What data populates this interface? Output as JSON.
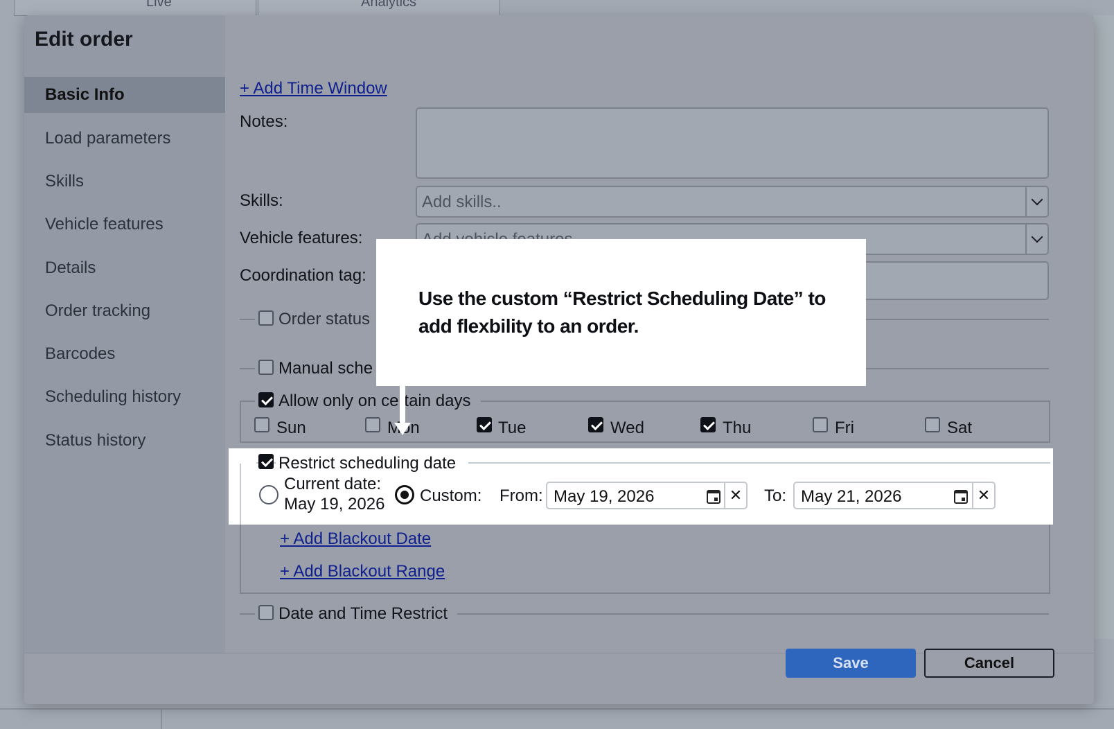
{
  "background": {
    "tabs": [
      {
        "label": "Live"
      },
      {
        "label": "Analytics"
      }
    ]
  },
  "modal": {
    "title": "Edit order",
    "nav": [
      {
        "label": "Basic Info",
        "active": true
      },
      {
        "label": "Load parameters"
      },
      {
        "label": "Skills"
      },
      {
        "label": "Vehicle features"
      },
      {
        "label": "Details"
      },
      {
        "label": "Order tracking"
      },
      {
        "label": "Barcodes"
      },
      {
        "label": "Scheduling history"
      },
      {
        "label": "Status history"
      }
    ],
    "form": {
      "add_time_window": "+ Add Time Window",
      "notes_label": "Notes:",
      "notes_value": "",
      "skills_label": "Skills:",
      "skills_placeholder": "Add skills..",
      "vehicle_features_label": "Vehicle features:",
      "vehicle_features_placeholder": "Add vehicle features",
      "coordination_tag_label": "Coordination tag:",
      "order_status_label": "Order status",
      "manual_schedule_label": "Manual sche",
      "allow_days_label": "Allow only on certain days",
      "days": [
        {
          "label": "Sun",
          "checked": false
        },
        {
          "label": "Mon",
          "checked": false
        },
        {
          "label": "Tue",
          "checked": true
        },
        {
          "label": "Wed",
          "checked": true
        },
        {
          "label": "Thu",
          "checked": true
        },
        {
          "label": "Fri",
          "checked": false
        },
        {
          "label": "Sat",
          "checked": false
        }
      ],
      "restrict_label": "Restrict scheduling date",
      "current_date_label": "Current date:",
      "current_date_value": "May 19, 2026",
      "custom_label": "Custom:",
      "from_label": "From:",
      "from_value": "May 19, 2026",
      "to_label": "To:",
      "to_value": "May 21, 2026",
      "clear_glyph": "✕",
      "add_blackout_date": "+ Add Blackout Date",
      "add_blackout_range": "+ Add Blackout Range",
      "date_time_restrict_label": "Date and Time Restrict"
    },
    "footer": {
      "save_label": "Save",
      "cancel_label": "Cancel"
    }
  },
  "callout": {
    "text": "Use the custom “Restrict Scheduling Date” to add flexbility to an order."
  }
}
